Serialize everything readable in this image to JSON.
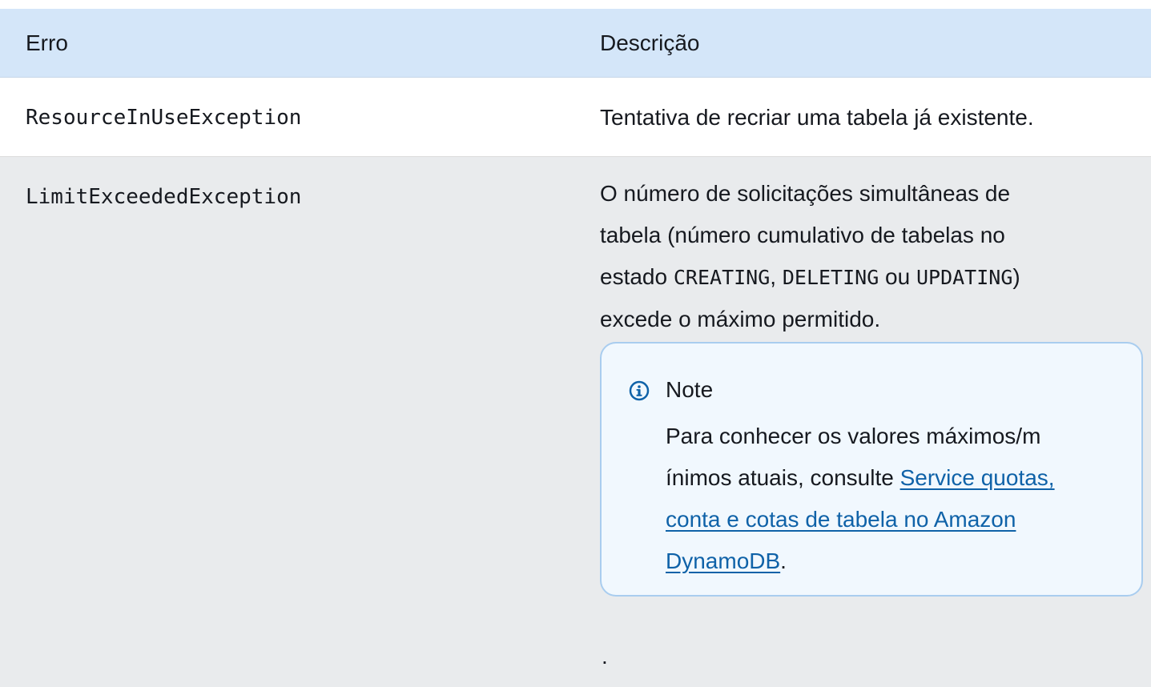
{
  "table": {
    "headers": [
      "Erro",
      "Descrição"
    ],
    "rows": [
      {
        "error": "ResourceInUseException",
        "description": "Tentativa de recriar uma tabela já existente."
      },
      {
        "error": "LimitExceededException",
        "description_parts": {
          "line1": "O número de solicitações simultâneas de",
          "line2": "tabela (número cumulativo de tabelas no",
          "line3_prefix": "estado ",
          "code1": "CREATING",
          "sep1": ", ",
          "code2": "DELETING",
          "sep2": " ou ",
          "code3": "UPDATING",
          "line3_suffix": ")",
          "line4": "excede o máximo permitido."
        },
        "note": {
          "title": "Note",
          "icon": "info-icon",
          "line1": "Para conhecer os valores máximos/m",
          "line2_prefix": "ínimos atuais, consulte ",
          "link_line1": "Service quotas,",
          "link_line2": "conta e cotas de tabela no Amazon",
          "link_line3": "DynamoDB",
          "suffix": "."
        },
        "trailing": "."
      }
    ]
  },
  "colors": {
    "header_bg": "#d4e6f9",
    "row_alt_bg": "#e9ebed",
    "note_bg": "#f1f8fe",
    "note_border": "#a9cdef",
    "link": "#0f62a8",
    "icon": "#0f62a8"
  }
}
